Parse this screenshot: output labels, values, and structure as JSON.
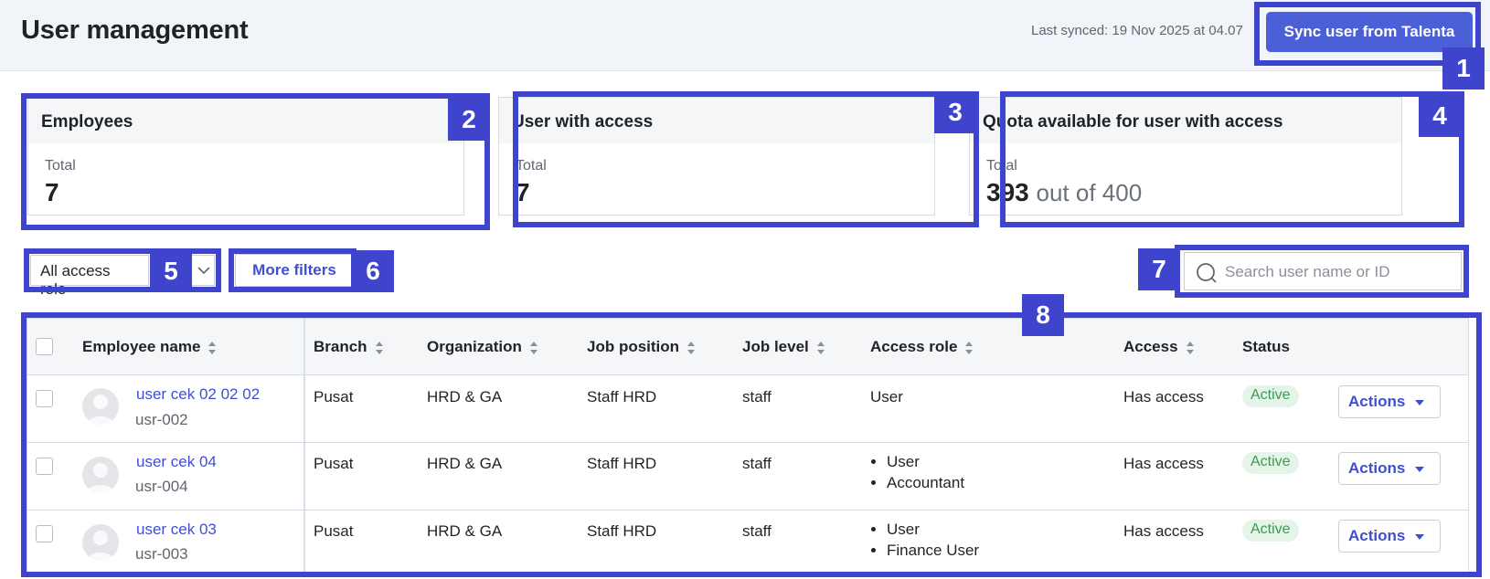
{
  "header": {
    "title": "User management",
    "last_synced": "Last synced: 19 Nov 2025 at 04.07",
    "sync_button": "Sync user from Talenta"
  },
  "stats": {
    "employees": {
      "title": "Employees",
      "label": "Total",
      "value": "7"
    },
    "user_with_access": {
      "title": "User with access",
      "label": "Total",
      "value": "7"
    },
    "quota": {
      "title": "Quota available for user with access",
      "label": "Total",
      "value": "393",
      "suffix": "out of 400"
    }
  },
  "filters": {
    "access_role": "All access role",
    "more_filters": "More filters",
    "search_placeholder": "Search user name or ID"
  },
  "table": {
    "columns": {
      "employee_name": "Employee name",
      "branch": "Branch",
      "organization": "Organization",
      "job_position": "Job position",
      "job_level": "Job level",
      "access_role": "Access role",
      "access": "Access",
      "status": "Status"
    },
    "rows": [
      {
        "name": "user cek 02 02 02",
        "id": "usr-002",
        "branch": "Pusat",
        "organization": "HRD & GA",
        "job_position": "Staff HRD",
        "job_level": "staff",
        "roles": [
          "User"
        ],
        "access": "Has access",
        "status": "Active",
        "actions": "Actions"
      },
      {
        "name": "user cek 04",
        "id": "usr-004",
        "branch": "Pusat",
        "organization": "HRD & GA",
        "job_position": "Staff HRD",
        "job_level": "staff",
        "roles": [
          "User",
          "Accountant"
        ],
        "access": "Has access",
        "status": "Active",
        "actions": "Actions"
      },
      {
        "name": "user cek 03",
        "id": "usr-003",
        "branch": "Pusat",
        "organization": "HRD & GA",
        "job_position": "Staff HRD",
        "job_level": "staff",
        "roles": [
          "User",
          "Finance User"
        ],
        "access": "Has access",
        "status": "Active",
        "actions": "Actions"
      }
    ]
  },
  "annotations": [
    "1",
    "2",
    "3",
    "4",
    "5",
    "6",
    "7",
    "8"
  ],
  "colors": {
    "accent": "#4b5fd6",
    "annotation": "#3f44cc",
    "link": "#3f4fd0",
    "active_bg": "#e5f4e8",
    "active_text": "#3b9a52"
  }
}
